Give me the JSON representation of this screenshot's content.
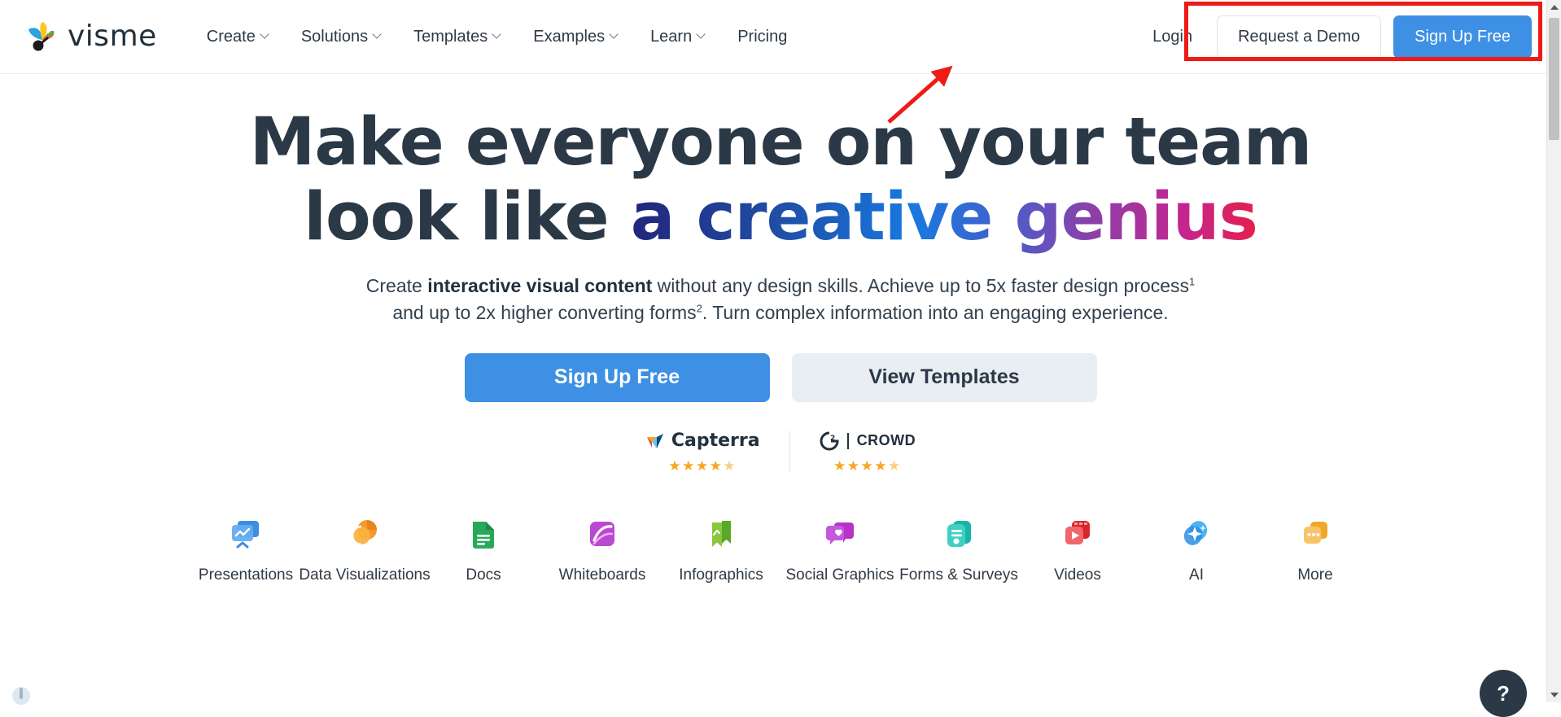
{
  "brand": {
    "name": "visme",
    "logo_icon": "visme-fan-logo"
  },
  "nav": {
    "items": [
      {
        "label": "Create",
        "has_dropdown": true
      },
      {
        "label": "Solutions",
        "has_dropdown": true
      },
      {
        "label": "Templates",
        "has_dropdown": true
      },
      {
        "label": "Examples",
        "has_dropdown": true
      },
      {
        "label": "Learn",
        "has_dropdown": true
      },
      {
        "label": "Pricing",
        "has_dropdown": false
      }
    ],
    "login_label": "Login",
    "demo_label": "Request a Demo",
    "signup_label": "Sign Up Free"
  },
  "annotation": {
    "highlight_color": "#ee1b16",
    "arrow_color": "#ee1b16",
    "target": "header-auth-group"
  },
  "hero": {
    "heading_line1": "Make everyone on your team",
    "heading_line2_plain": "look like ",
    "heading_line2_gradient": "a creative genius",
    "heading_color": "#2b3947",
    "gradient_start": "#22267b",
    "gradient_mid": "#1878e0",
    "gradient_end": "#e51f4b",
    "sub_line1_a": "Create ",
    "sub_line1_bold": "interactive visual content",
    "sub_line1_b": " without any design skills. Achieve up to 5x faster design process",
    "sub_line1_sup": "1",
    "sub_line2_a": "and up to 2x higher converting forms",
    "sub_line2_sup": "2",
    "sub_line2_b": ". Turn complex information into an engaging experience.",
    "cta_primary": "Sign Up Free",
    "cta_secondary": "View Templates",
    "primary_color": "#3d90e3",
    "secondary_color": "#e9eef2"
  },
  "badges": [
    {
      "name": "Capterra",
      "icon": "capterra-logo",
      "stars": "★★★★",
      "half": "★",
      "rating": 4.5
    },
    {
      "name": "CROWD",
      "icon": "g2-crowd-logo",
      "stars": "★★★★",
      "half": "★",
      "rating": 4.5,
      "prefix": "G2"
    }
  ],
  "categories": [
    {
      "label": "Presentations",
      "icon": "presentations-icon"
    },
    {
      "label": "Data Visualizations",
      "icon": "data-visualizations-icon"
    },
    {
      "label": "Docs",
      "icon": "docs-icon"
    },
    {
      "label": "Whiteboards",
      "icon": "whiteboards-icon"
    },
    {
      "label": "Infographics",
      "icon": "infographics-icon"
    },
    {
      "label": "Social Graphics",
      "icon": "social-graphics-icon"
    },
    {
      "label": "Forms & Surveys",
      "icon": "forms-surveys-icon"
    },
    {
      "label": "Videos",
      "icon": "videos-icon"
    },
    {
      "label": "AI",
      "icon": "ai-icon"
    },
    {
      "label": "More",
      "icon": "more-icon"
    }
  ],
  "chat": {
    "label": "?"
  }
}
